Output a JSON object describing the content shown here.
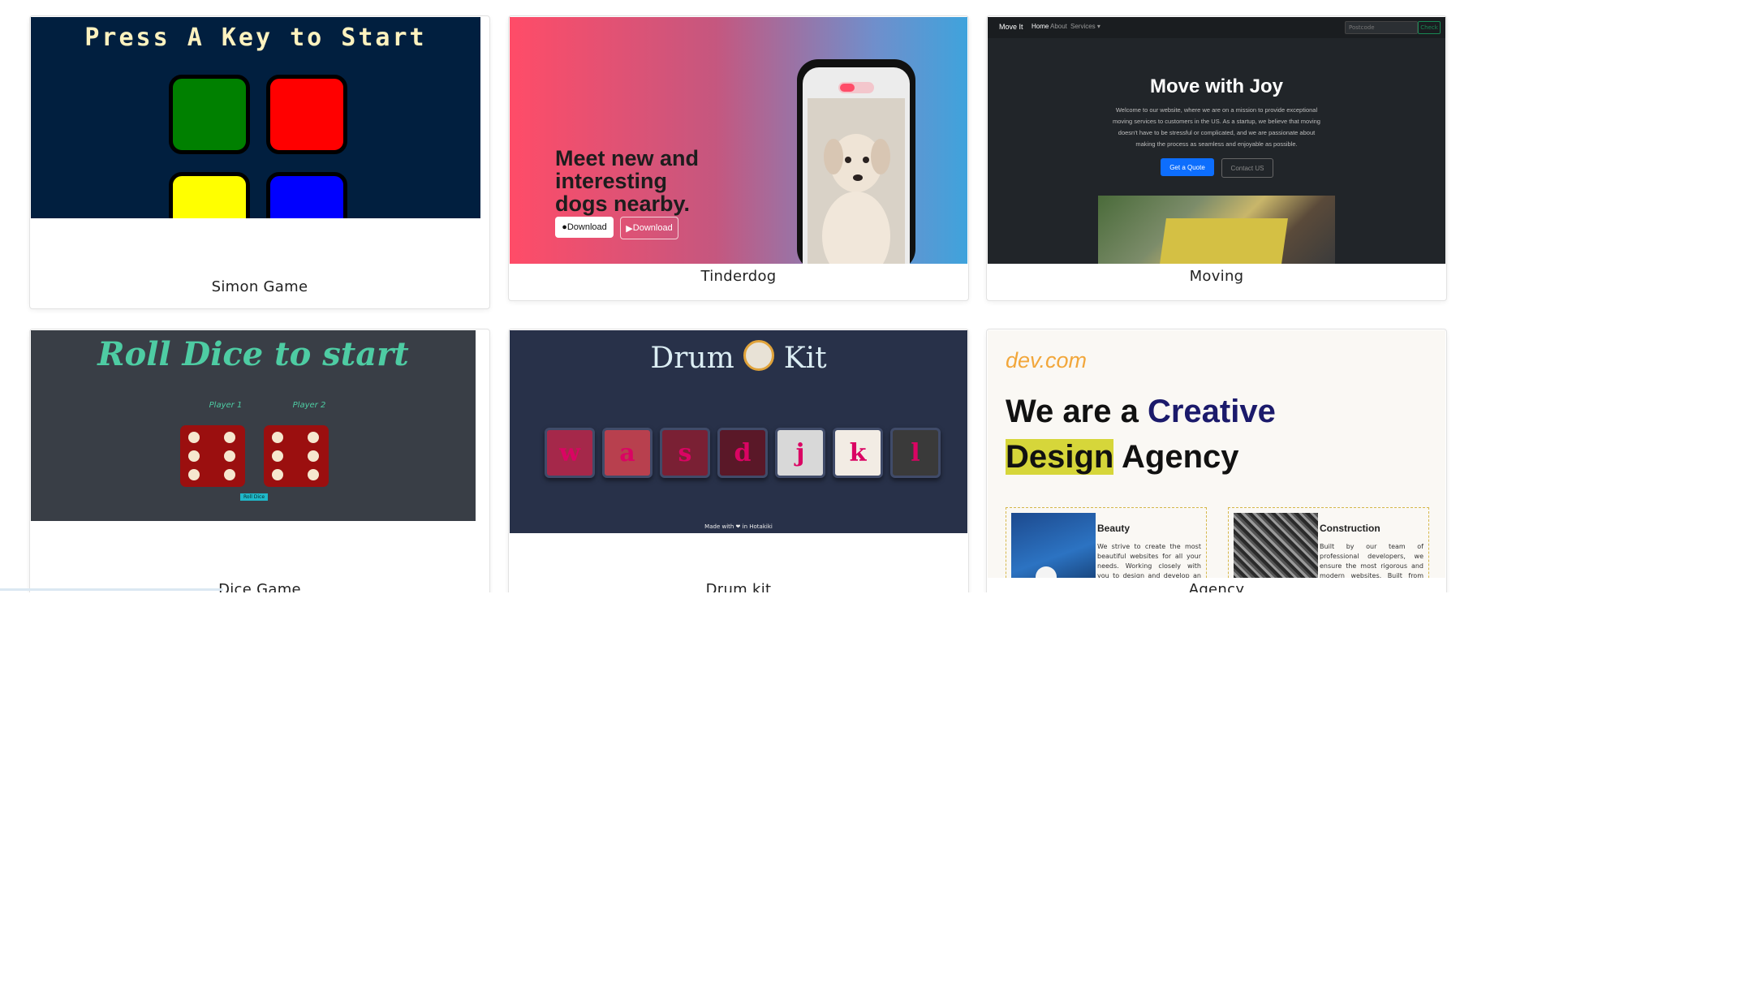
{
  "cards": [
    {
      "caption": "Simon Game",
      "screen_title": "Press A Key to Start",
      "colors": [
        "#008000",
        "#ff0000",
        "#ffff00",
        "#0000ff"
      ]
    },
    {
      "caption": "Tinderdog",
      "headline": "Meet new and interesting dogs nearby.",
      "download_1": "Download",
      "download_2": "Download"
    },
    {
      "caption": "Moving",
      "nav_brand": "Move It",
      "nav_home": "Home",
      "nav_about": "About",
      "nav_services": "Services ▾",
      "postcode_placeholder": "Postcode",
      "check_label": "Check",
      "title": "Move with Joy",
      "body": "Welcome to our website, where we are on a mission to provide exceptional moving services to customers in the US. As a startup, we believe that moving doesn't have to be stressful or complicated, and we are passionate about making the process as seamless and enjoyable as possible.",
      "quote_label": "Get a Quote",
      "contact_label": "Contact US"
    },
    {
      "caption": "Dice Game",
      "title": "Roll Dice to start",
      "player1": "Player 1",
      "player2": "Player 2",
      "roll_label": "Roll Dice"
    },
    {
      "caption": "Drum kit",
      "title_left": "Drum",
      "title_right": "Kit",
      "keys": [
        "w",
        "a",
        "s",
        "d",
        "j",
        "k",
        "l"
      ],
      "footer": "Made with ❤ in Hotakiki"
    },
    {
      "caption": "Agency",
      "logo": "dev.com",
      "h1_a": "We are a",
      "h1_b": "Creative",
      "h2_a": "Design",
      "h2_b": "Agency",
      "box1_title": "Beauty",
      "box1_text": "We strive to create the most beautiful websites for all your needs. Working closely with you to design and develop an amazing website for your",
      "box2_title": "Construction",
      "box2_text": "Built by our team of professional developers, we ensure the most rigorous and modern websites. Built from scratch using HTML and CSS."
    }
  ]
}
